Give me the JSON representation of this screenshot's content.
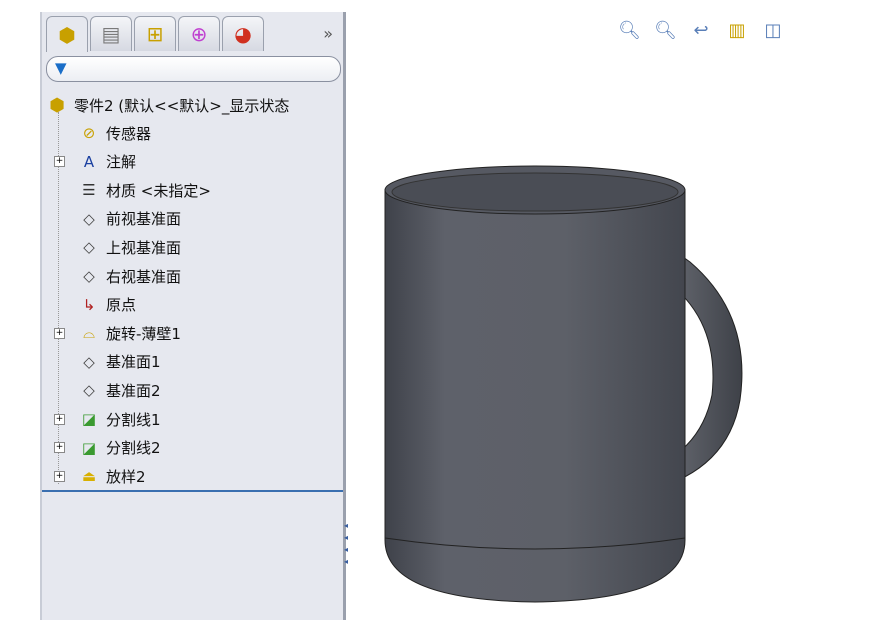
{
  "panel": {
    "tabs": [
      {
        "icon": "feature-manager-icon"
      },
      {
        "icon": "property-manager-icon"
      },
      {
        "icon": "configuration-manager-icon"
      },
      {
        "icon": "dimxpert-icon"
      },
      {
        "icon": "display-manager-icon"
      }
    ],
    "more": "»",
    "filter_icon": "filter-icon"
  },
  "tree": {
    "root": "零件2  (默认<<默认>_显示状态",
    "items": [
      {
        "label": "传感器",
        "icon": "sensor-folder-icon",
        "expand": false
      },
      {
        "label": "注解",
        "icon": "annotation-folder-icon",
        "expand": true
      },
      {
        "label": "材质 <未指定>",
        "icon": "material-icon",
        "expand": false
      },
      {
        "label": "前视基准面",
        "icon": "plane-icon",
        "expand": false
      },
      {
        "label": "上视基准面",
        "icon": "plane-icon",
        "expand": false
      },
      {
        "label": "右视基准面",
        "icon": "plane-icon",
        "expand": false
      },
      {
        "label": "原点",
        "icon": "origin-icon",
        "expand": false
      },
      {
        "label": "旋转-薄壁1",
        "icon": "revolve-icon",
        "expand": true
      },
      {
        "label": "基准面1",
        "icon": "plane-icon",
        "expand": false
      },
      {
        "label": "基准面2",
        "icon": "plane-icon",
        "expand": false
      },
      {
        "label": "分割线1",
        "icon": "split-line-icon",
        "expand": true
      },
      {
        "label": "分割线2",
        "icon": "split-line-icon",
        "expand": true
      },
      {
        "label": "放样2",
        "icon": "loft-icon",
        "expand": true
      }
    ]
  },
  "toolbar": [
    "zoom-to-fit-icon",
    "zoom-to-area-icon",
    "previous-view-icon",
    "section-view-icon",
    "view-orientation-icon"
  ],
  "model": {
    "color": "#5b5e66"
  }
}
